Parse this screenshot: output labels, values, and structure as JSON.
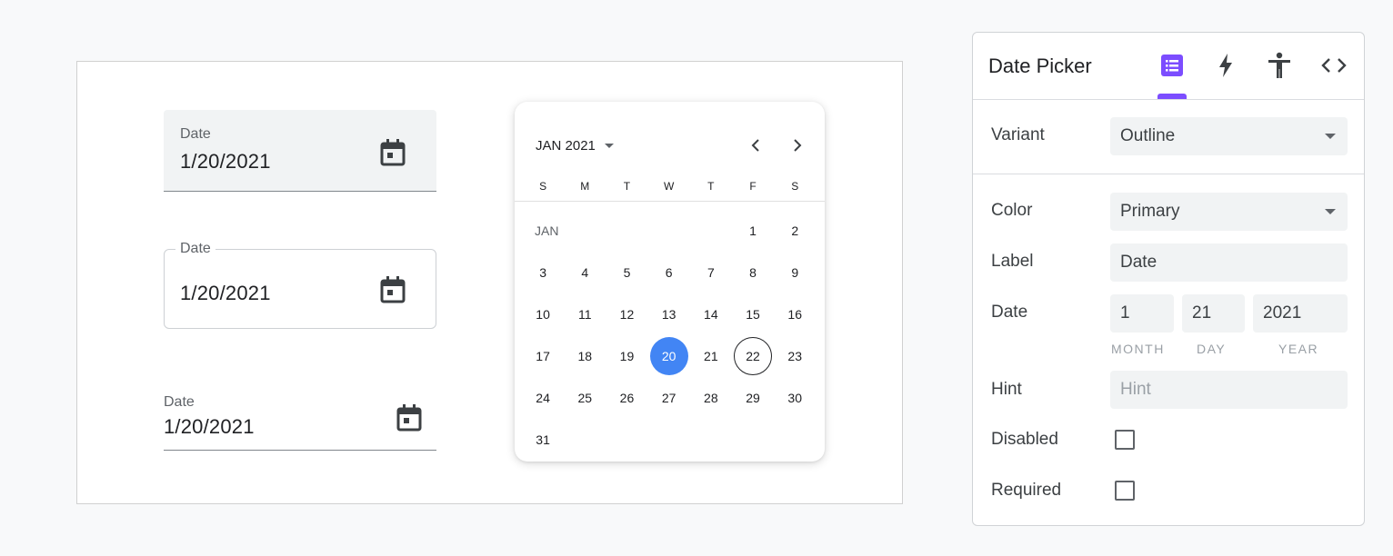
{
  "fields": {
    "filled": {
      "label": "Date",
      "value": "1/20/2021"
    },
    "outline": {
      "label": "Date",
      "value": "1/20/2021"
    },
    "standard": {
      "label": "Date",
      "value": "1/20/2021"
    },
    "icon": "calendar-icon"
  },
  "calendar": {
    "month_year": "JAN 2021",
    "weekdays": [
      "S",
      "M",
      "T",
      "W",
      "T",
      "F",
      "S"
    ],
    "month_label": "JAN",
    "weeks": [
      [
        "",
        "",
        "",
        "",
        "",
        "1",
        "2"
      ],
      [
        "3",
        "4",
        "5",
        "6",
        "7",
        "8",
        "9"
      ],
      [
        "10",
        "11",
        "12",
        "13",
        "14",
        "15",
        "16"
      ],
      [
        "17",
        "18",
        "19",
        "20",
        "21",
        "22",
        "23"
      ],
      [
        "24",
        "25",
        "26",
        "27",
        "28",
        "29",
        "30"
      ],
      [
        "31",
        "",
        "",
        "",
        "",
        "",
        ""
      ]
    ],
    "selected_day": "20",
    "today_day": "22",
    "selected_color": "#4285f4"
  },
  "panel": {
    "title": "Date Picker",
    "tabs": [
      "list-icon",
      "bolt-icon",
      "accessibility-icon",
      "code-icon"
    ],
    "active_tab_color": "#7c4dff",
    "variant": {
      "label": "Variant",
      "value": "Outline"
    },
    "color": {
      "label": "Color",
      "value": "Primary"
    },
    "label_field": {
      "label": "Label",
      "value": "Date"
    },
    "date": {
      "label": "Date",
      "month": "1",
      "day": "21",
      "year": "2021",
      "month_label": "MONTH",
      "day_label": "DAY",
      "year_label": "YEAR"
    },
    "hint": {
      "label": "Hint",
      "placeholder": "Hint"
    },
    "disabled": {
      "label": "Disabled",
      "checked": false
    },
    "required": {
      "label": "Required",
      "checked": false
    }
  }
}
